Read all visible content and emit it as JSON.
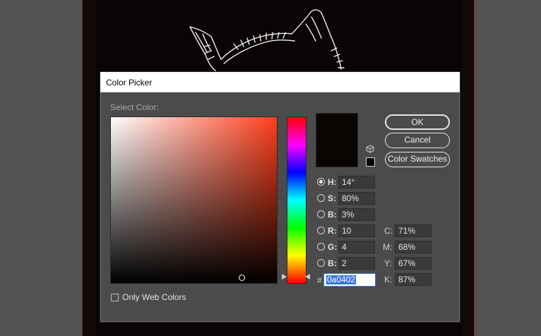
{
  "dialog": {
    "title": "Color Picker",
    "select_label": "Select Color:",
    "current_color": "#0a0402",
    "hue_gradient_top": "#ff3e1a"
  },
  "buttons": {
    "ok": "OK",
    "cancel": "Cancel",
    "color_swatches": "Color Swatches"
  },
  "hsb": {
    "h": {
      "label": "H:",
      "value": "14°",
      "selected": true
    },
    "s": {
      "label": "S:",
      "value": "80%",
      "selected": false
    },
    "b": {
      "label": "B:",
      "value": "3%",
      "selected": false
    }
  },
  "rgb": {
    "r": {
      "label": "R:",
      "value": "10",
      "selected": false
    },
    "g": {
      "label": "G:",
      "value": "4",
      "selected": false
    },
    "b": {
      "label": "B:",
      "value": "2",
      "selected": false
    }
  },
  "cmyk": {
    "c": {
      "label": "C:",
      "value": "71%"
    },
    "m": {
      "label": "M:",
      "value": "68%"
    },
    "y": {
      "label": "Y:",
      "value": "67%"
    },
    "k": {
      "label": "K:",
      "value": "87%"
    }
  },
  "hex": {
    "prefix": "#",
    "value": "0a0402"
  },
  "web_colors": {
    "label": "Only Web Colors",
    "checked": false
  },
  "icons": {
    "out_of_gamut": "cube-warning-icon",
    "web_safe": "web-safe-swatch"
  }
}
